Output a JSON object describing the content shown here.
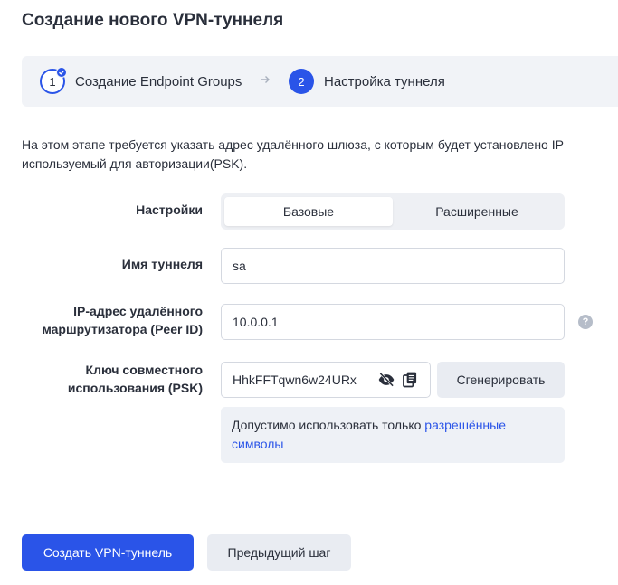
{
  "page": {
    "title": "Создание нового VPN-туннеля"
  },
  "stepper": {
    "steps": [
      {
        "number": "1",
        "label": "Создание Endpoint Groups",
        "state": "done"
      },
      {
        "number": "2",
        "label": "Настройка туннеля",
        "state": "active"
      }
    ],
    "separator_icon": "arrow-right-icon"
  },
  "description": {
    "line1": "На этом этапе требуется указать адрес удалённого шлюза, с которым будет установлено IP",
    "line2": "используемый для авторизации(PSK)."
  },
  "form": {
    "settings": {
      "label": "Настройки",
      "options": [
        "Базовые",
        "Расширенные"
      ],
      "selected": "Базовые"
    },
    "tunnel_name": {
      "label": "Имя туннеля",
      "value": "sa"
    },
    "peer_ip": {
      "label_line1": "IP-адрес удалённого",
      "label_line2": "маршрутизатора (Peer ID)",
      "value": "10.0.0.1",
      "help_icon": "question-icon",
      "help_text": "?"
    },
    "psk": {
      "label_line1": "Ключ совместного",
      "label_line2": "использования (PSK)",
      "value": "HhkFFTqwn6w24URx",
      "visibility_icon": "eye-off-icon",
      "copy_icon": "copy-icon",
      "generate_label": "Сгенерировать"
    },
    "hint": {
      "text": "Допустимо использовать только ",
      "link_text": "разрешённые символы"
    }
  },
  "actions": {
    "create_label": "Создать VPN-туннель",
    "previous_label": "Предыдущий шаг"
  },
  "colors": {
    "accent": "#2a54e8",
    "stepper_bg": "#f1f3f7",
    "secondary_button_bg": "#e9ecf2",
    "hint_bg": "#eef1f6"
  }
}
